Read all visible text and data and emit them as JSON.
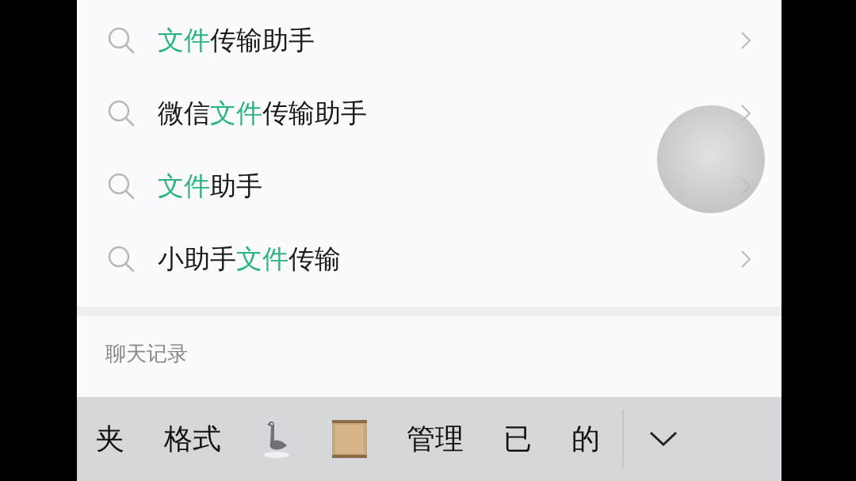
{
  "suggestions": [
    {
      "segments": [
        {
          "text": "文件",
          "highlight": true
        },
        {
          "text": "传输助手",
          "highlight": false
        }
      ]
    },
    {
      "segments": [
        {
          "text": "微信",
          "highlight": false
        },
        {
          "text": "文件",
          "highlight": true
        },
        {
          "text": "传输助手",
          "highlight": false
        }
      ]
    },
    {
      "segments": [
        {
          "text": "文件",
          "highlight": true
        },
        {
          "text": "助手",
          "highlight": false
        }
      ]
    },
    {
      "segments": [
        {
          "text": "小助手",
          "highlight": false
        },
        {
          "text": "文件",
          "highlight": true
        },
        {
          "text": "传输",
          "highlight": false
        }
      ]
    }
  ],
  "section_title": "聊天记录",
  "floating_button": {
    "kind": "assistive"
  },
  "candidates": [
    {
      "kind": "text",
      "text": "夹"
    },
    {
      "kind": "text",
      "text": "格式"
    },
    {
      "kind": "bird"
    },
    {
      "kind": "scroll"
    },
    {
      "kind": "text",
      "text": "管理"
    },
    {
      "kind": "text",
      "text": "已"
    },
    {
      "kind": "text",
      "text": "的"
    }
  ]
}
